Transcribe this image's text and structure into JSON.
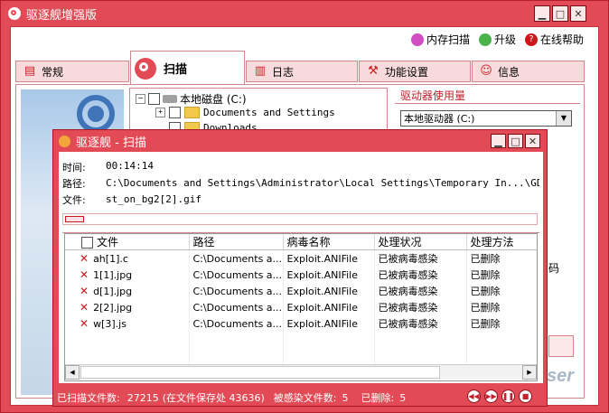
{
  "app": {
    "title": "驱逐舰增强版"
  },
  "links": {
    "memory_scan": "内存扫描",
    "upgrade": "升级",
    "online_help": "在线帮助"
  },
  "tabs": [
    {
      "label": "常规"
    },
    {
      "label": "扫描"
    },
    {
      "label": "日志"
    },
    {
      "label": "功能设置"
    },
    {
      "label": "信息"
    }
  ],
  "tree": {
    "root": "本地磁盘 (C:)",
    "items": [
      "Documents and Settings",
      "Downloads"
    ]
  },
  "drive": {
    "label": "驱动器使用量",
    "selected": "本地驱动器 (C:)"
  },
  "background_fragments": {
    "right_text": "码",
    "brand": "ser"
  },
  "dialog": {
    "title": "驱逐舰 - 扫描",
    "time_label": "时间:",
    "time_value": "00:14:14",
    "path_label": "路径:",
    "path_value": "C:\\Documents and Settings\\Administrator\\Local Settings\\Temporary In...\\GDRXOTIX",
    "file_label": "文件:",
    "file_value": "st_on_bg2[2].gif",
    "progress": 0.04,
    "columns": [
      "文件",
      "路径",
      "病毒名称",
      "处理状况",
      "处理方法"
    ],
    "rows": [
      [
        "ah[1].c",
        "C:\\Documents a...",
        "Exploit.ANIFile",
        "已被病毒感染",
        "已删除"
      ],
      [
        "1[1].jpg",
        "C:\\Documents a...",
        "Exploit.ANIFile",
        "已被病毒感染",
        "已删除"
      ],
      [
        "d[1].jpg",
        "C:\\Documents a...",
        "Exploit.ANIFile",
        "已被病毒感染",
        "已删除"
      ],
      [
        "2[2].jpg",
        "C:\\Documents a...",
        "Exploit.ANIFile",
        "已被病毒感染",
        "已删除"
      ],
      [
        "w[3].js",
        "C:\\Documents a...",
        "Exploit.ANIFile",
        "已被病毒感染",
        "已删除"
      ]
    ],
    "status": {
      "scanned_label": "已扫描文件数:",
      "scanned": "27215",
      "saved_note": "(在文件保存处 43636)",
      "infected_label": "被感染文件数:",
      "infected": "5",
      "deleted_label": "已删除:",
      "deleted": "5"
    }
  },
  "colors": {
    "frame": "#e24b56",
    "accent_dark": "#b21e2a",
    "tab_bg": "#f7dadc"
  }
}
